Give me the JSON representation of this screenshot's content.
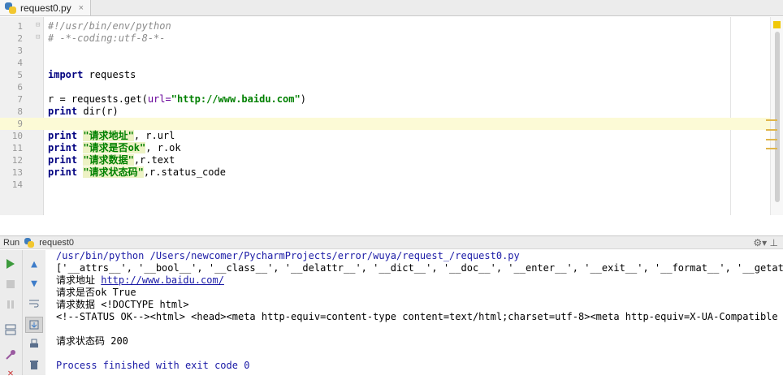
{
  "tab": {
    "filename": "request0.py",
    "close": "×"
  },
  "editor": {
    "line_numbers": [
      "1",
      "2",
      "3",
      "4",
      "5",
      "6",
      "7",
      "8",
      "9",
      "10",
      "11",
      "12",
      "13",
      "14"
    ],
    "line1": "#!/usr/bin/env/python",
    "line2": "# -*-coding:utf-8-*-",
    "line5_kw": "import",
    "line5_rest": " requests",
    "line7_a": "r = requests.get(",
    "line7_param": "url=",
    "line7_str": "\"http://www.baidu.com\"",
    "line7_b": ")",
    "line8_kw": "print",
    "line8_rest": " dir(r)",
    "line10_kw": "print",
    "line10_str": "\"请求地址\"",
    "line10_rest": ", r.url",
    "line11_kw": "print",
    "line11_str": "\"请求是否ok\"",
    "line11_rest": ", r.ok",
    "line12_kw": "print",
    "line12_str": "\"请求数据\"",
    "line12_rest": ",r.text",
    "line13_kw": "print",
    "line13_str": "\"请求状态码\"",
    "line13_rest": ",r.status_code"
  },
  "run": {
    "label": "Run",
    "config_name": "request0",
    "settings_icon": "⚙▾",
    "minimize_icon": "⊥"
  },
  "console": {
    "cmd": "/usr/bin/python /Users/newcomer/PycharmProjects/error/wuya/request_/request0.py",
    "dir_output": "['__attrs__', '__bool__', '__class__', '__delattr__', '__dict__', '__doc__', '__enter__', '__exit__', '__format__', '__getattrib",
    "url_label": "请求地址 ",
    "url": "http://www.baidu.com/",
    "ok_line": "请求是否ok True",
    "data_line": "请求数据 <!DOCTYPE html>",
    "html_line": "<!--STATUS OK--><html> <head><meta http-equiv=content-type content=text/html;charset=utf-8><meta http-equiv=X-UA-Compatible cont",
    "status_line": "请求状态码 200",
    "finish_line": "Process finished with exit code 0"
  },
  "colors": {
    "keyword": "#000080",
    "string": "#008000",
    "comment": "#8c8c8c",
    "current_line": "#fcfad6",
    "run_green": "#3c9a3c",
    "console_blue": "#1a1aa6"
  }
}
